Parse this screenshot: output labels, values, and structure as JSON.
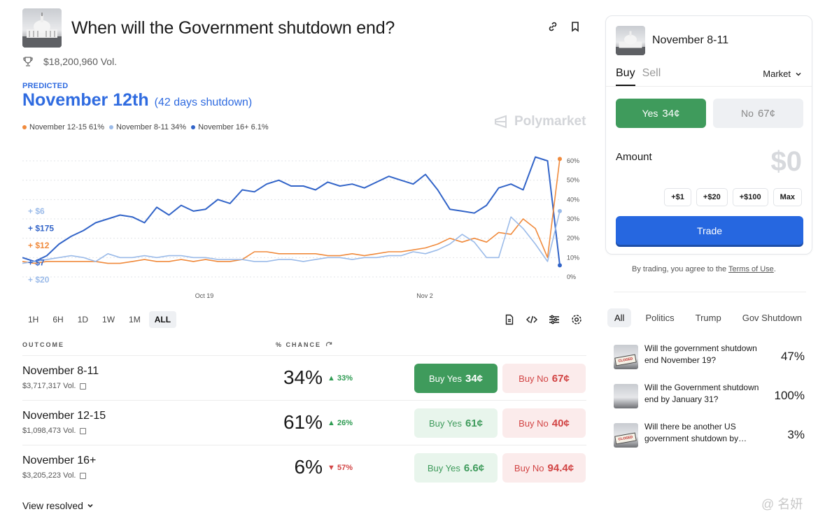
{
  "header": {
    "title": "When will the Government shutdown end?",
    "volume": "$18,200,960 Vol."
  },
  "prediction": {
    "label": "PREDICTED",
    "value": "November 12th",
    "note": "(42 days shutdown)"
  },
  "legend": [
    {
      "label": "November 12-15 61%",
      "color": "#f08a3c"
    },
    {
      "label": "November 8-11 34%",
      "color": "#9bbbe9"
    },
    {
      "label": "November 16+ 6.1%",
      "color": "#3264c8"
    }
  ],
  "watermark": "Polymarket",
  "chart_data": {
    "type": "line",
    "x_ticks": [
      "Oct 19",
      "Nov 2"
    ],
    "y_ticks": [
      "60%",
      "50%",
      "40%",
      "30%",
      "20%",
      "10%",
      "0%"
    ],
    "ylim": [
      0,
      65
    ],
    "trade_annotations": [
      "+ $6",
      "+ $175",
      "+ $12",
      "+ $7",
      "+ $20"
    ],
    "series": [
      {
        "color": "#3264c8",
        "values": [
          10,
          8,
          11,
          17,
          21,
          24,
          28,
          30,
          32,
          31,
          28,
          36,
          32,
          37,
          34,
          35,
          40,
          38,
          45,
          44,
          48,
          50,
          47,
          47,
          45,
          49,
          47,
          48,
          46,
          49,
          52,
          50,
          48,
          53,
          45,
          35,
          34,
          33,
          37,
          46,
          48,
          45,
          62,
          60,
          6
        ]
      },
      {
        "color": "#f08a3c",
        "values": [
          8,
          7,
          8,
          8,
          8,
          8,
          8,
          7,
          7,
          8,
          9,
          8,
          8,
          9,
          8,
          9,
          8,
          8,
          9,
          13,
          13,
          12,
          12,
          12,
          12,
          11,
          11,
          12,
          11,
          12,
          13,
          13,
          14,
          15,
          17,
          20,
          18,
          20,
          18,
          23,
          22,
          30,
          25,
          10,
          61
        ]
      },
      {
        "color": "#9bbbe9",
        "values": [
          7,
          8,
          9,
          10,
          11,
          10,
          8,
          12,
          10,
          10,
          11,
          10,
          11,
          11,
          10,
          10,
          9,
          9,
          9,
          8,
          8,
          9,
          9,
          8,
          9,
          10,
          10,
          9,
          10,
          10,
          11,
          11,
          13,
          12,
          14,
          17,
          22,
          18,
          10,
          10,
          31,
          25,
          17,
          8,
          34
        ]
      }
    ]
  },
  "ranges": [
    "1H",
    "6H",
    "1D",
    "1W",
    "1M",
    "ALL"
  ],
  "table": {
    "outcome_header": "OUTCOME",
    "chance_header": "% CHANCE",
    "rows": [
      {
        "name": "November 8-11",
        "vol": "$3,717,317 Vol.",
        "pct": "34%",
        "change": "33%",
        "dir": "up",
        "yes_label": "Buy Yes",
        "yes_price": "34¢",
        "no_label": "Buy No",
        "no_price": "67¢"
      },
      {
        "name": "November 12-15",
        "vol": "$1,098,473 Vol.",
        "pct": "61%",
        "change": "26%",
        "dir": "up",
        "yes_label": "Buy Yes",
        "yes_price": "61¢",
        "no_label": "Buy No",
        "no_price": "40¢"
      },
      {
        "name": "November 16+",
        "vol": "$3,205,223 Vol.",
        "pct": "6%",
        "change": "57%",
        "dir": "down",
        "yes_label": "Buy Yes",
        "yes_price": "6.6¢",
        "no_label": "Buy No",
        "no_price": "94.4¢"
      }
    ],
    "view_resolved": "View resolved"
  },
  "panel": {
    "title": "November 8-11",
    "tab_buy": "Buy",
    "tab_sell": "Sell",
    "order_type": "Market",
    "yes_label": "Yes",
    "yes_price": "34¢",
    "no_label": "No",
    "no_price": "67¢",
    "amount_label": "Amount",
    "amount_value": "$0",
    "chips": [
      "+$1",
      "+$20",
      "+$100",
      "Max"
    ],
    "trade_label": "Trade"
  },
  "terms": {
    "prefix": "By trading, you agree to the ",
    "link": "Terms of Use",
    "suffix": "."
  },
  "categories": [
    "All",
    "Politics",
    "Trump",
    "Gov Shutdown"
  ],
  "related": [
    {
      "text": "Will the government shutdown end November 19?",
      "pct": "47%"
    },
    {
      "text": "Will the Government shutdown end by January 31?",
      "pct": "100%"
    },
    {
      "text": "Will there be another US government shutdown by…",
      "pct": "3%"
    }
  ],
  "corner_watermark": "@ 名妍"
}
